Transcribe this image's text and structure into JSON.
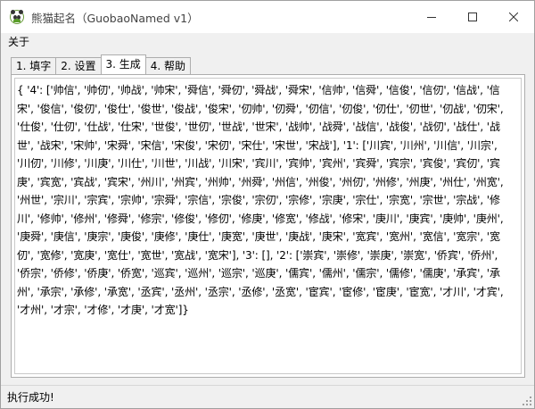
{
  "window": {
    "title": "熊猫起名（GuobaoNamed v1）",
    "controls": {
      "minimize": "minimize-icon",
      "maximize": "maximize-icon",
      "close": "close-icon"
    }
  },
  "menu": {
    "items": [
      {
        "label": "关于"
      }
    ]
  },
  "tabs": [
    {
      "label": "1. 填字",
      "active": false
    },
    {
      "label": "2. 设置",
      "active": false
    },
    {
      "label": "3. 生成",
      "active": true
    },
    {
      "label": "4. 帮助",
      "active": false
    }
  ],
  "output": {
    "text": "{ '4': ['帅信', '帅仞', '帅战', '帅宋', '舜信', '舜仞', '舜战', '舜宋', '信帅', '信舜', '信俊', '信仞', '信战', '信宋', '俊信', '俊仞', '俊仕', '俊世', '俊战', '俊宋', '仞帅', '仞舜', '仞信', '仞俊', '仞仕', '仞世', '仞战', '仞宋', '仕俊', '仕仞', '仕战', '仕宋', '世俊', '世仞', '世战', '世宋', '战帅', '战舜', '战信', '战俊', '战仞', '战仕', '战世', '战宋', '宋帅', '宋舜', '宋信', '宋俊', '宋仞', '宋仕', '宋世', '宋战'], '1': ['川宾', '川州', '川信', '川宗', '川仞', '川修', '川庚', '川仕', '川世', '川战', '川宋', '宾川', '宾帅', '宾州', '宾舜', '宾宗', '宾俊', '宾仞', '宾庚', '宾宽', '宾战', '宾宋', '州川', '州宾', '州帅', '州舜', '州信', '州俊', '州仞', '州修', '州庚', '州仕', '州宽', '州世', '宗川', '宗宾', '宗帅', '宗舜', '宗信', '宗俊', '宗仞', '宗修', '宗庚', '宗仕', '宗宽', '宗世', '宗战', '修川', '修帅', '修州', '修舜', '修宗', '修俊', '修仞', '修庚', '修宽', '修战', '修宋', '庚川', '庚宾', '庚帅', '庚州', '庚舜', '庚信', '庚宗', '庚俊', '庚修', '庚仕', '庚宽', '庚世', '庚战', '庚宋', '宽宾', '宽州', '宽信', '宽宗', '宽仞', '宽修', '宽庚', '宽仕', '宽世', '宽战', '宽宋'], '3': [], '2': ['崇宾', '崇修', '崇庚', '崇宽', '侨宾', '侨州', '侨宗', '侨修', '侨庚', '侨宽', '巡宾', '巡州', '巡宗', '巡庚', '儒宾', '儒州', '儒宗', '儒修', '儒庚', '承宾', '承州', '承宗', '承修', '承宽', '丞宾', '丞州', '丞宗', '丞修', '丞宽', '宦宾', '宦修', '宦庚', '宦宽', '才川', '才宾', '才州', '才宗', '才修', '才庚', '才宽']}"
  },
  "status": {
    "text": "执行成功!"
  }
}
